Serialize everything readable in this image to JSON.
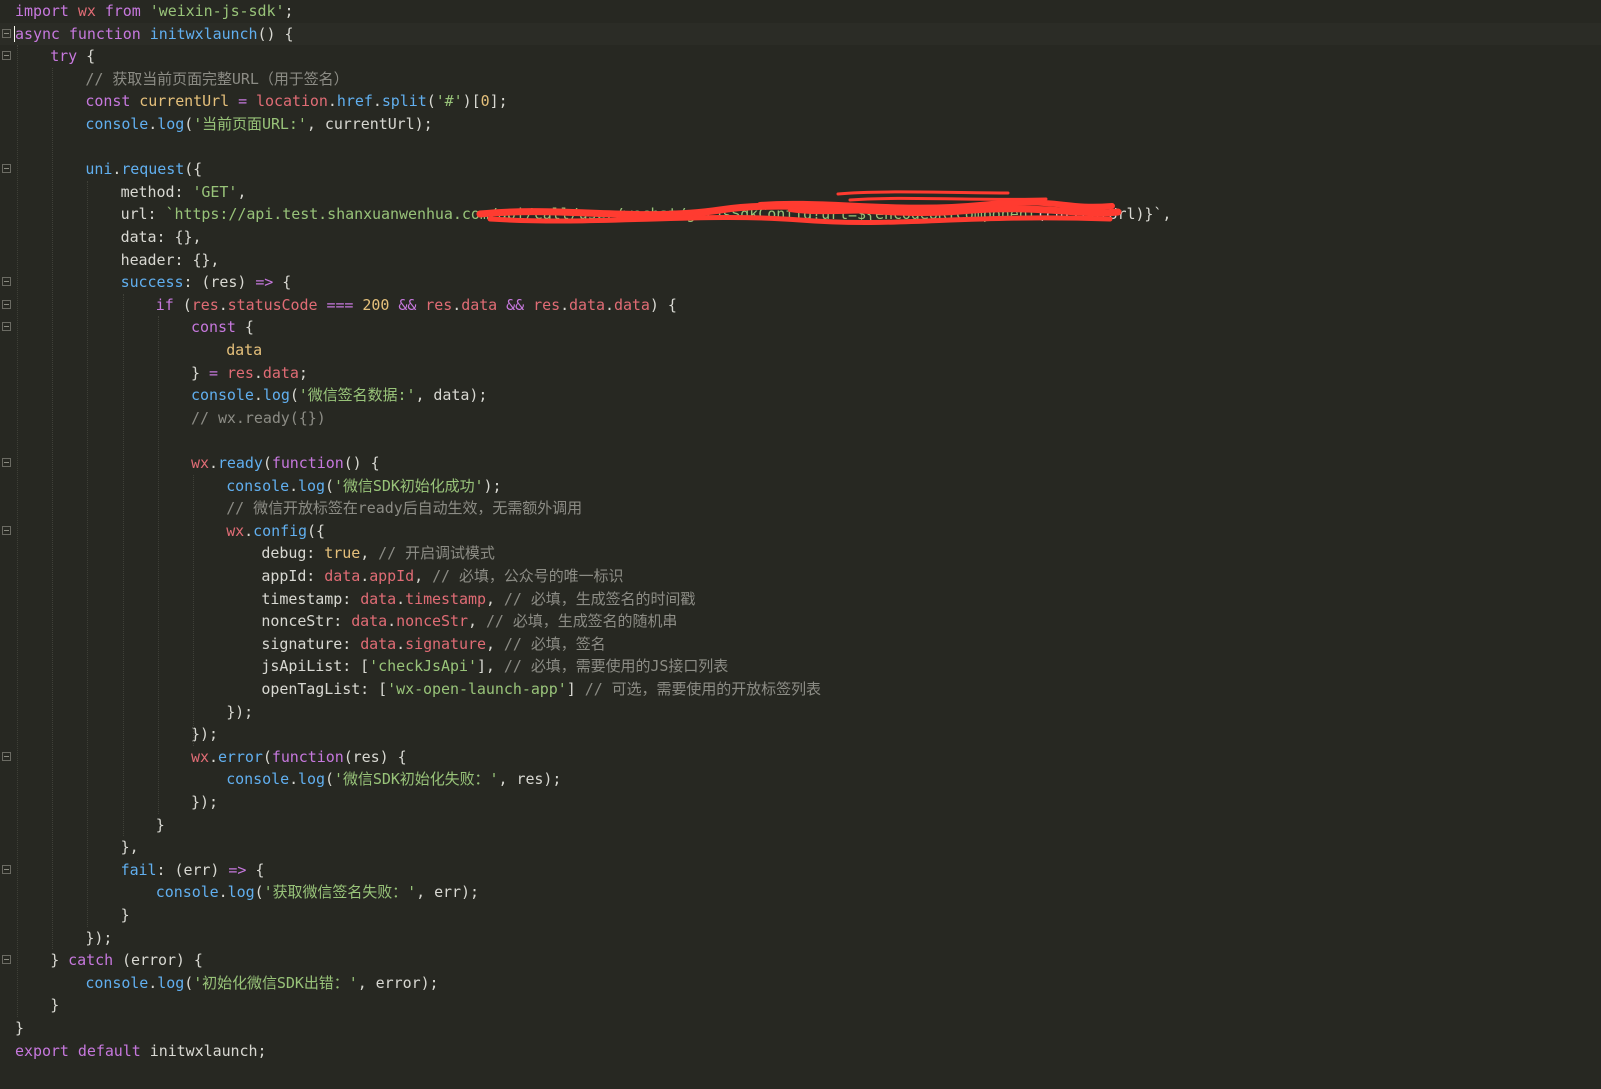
{
  "colors": {
    "background": "#272822",
    "text": "#d8d8d2",
    "keyword": "#c678dd",
    "function": "#61afef",
    "string": "#98c379",
    "number": "#e5c07b",
    "comment": "#8c8c85",
    "property": "#e06c75",
    "boolean": "#e5c07b",
    "redaction": "#ff3b30"
  },
  "editor": {
    "active_line": 2,
    "redaction_note": "redacted-url-segment"
  },
  "lines": [
    {
      "indent": 0,
      "fold": false,
      "tokens": [
        [
          "kw",
          "import"
        ],
        [
          "p",
          " "
        ],
        [
          "prop",
          "wx"
        ],
        [
          "p",
          " "
        ],
        [
          "kw",
          "from"
        ],
        [
          "p",
          " "
        ],
        [
          "str",
          "'weixin-js-sdk'"
        ],
        [
          "p",
          ";"
        ]
      ]
    },
    {
      "indent": 0,
      "fold": true,
      "tokens": [
        [
          "kw",
          "async"
        ],
        [
          "p",
          " "
        ],
        [
          "kw",
          "function"
        ],
        [
          "p",
          " "
        ],
        [
          "fn",
          "initwxlaunch"
        ],
        [
          "p",
          "() {"
        ]
      ]
    },
    {
      "indent": 1,
      "fold": true,
      "tokens": [
        [
          "kw",
          "try"
        ],
        [
          "p",
          " {"
        ]
      ]
    },
    {
      "indent": 2,
      "fold": false,
      "tokens": [
        [
          "cm",
          "// 获取当前页面完整URL（用于签名）"
        ]
      ]
    },
    {
      "indent": 2,
      "fold": false,
      "tokens": [
        [
          "kw",
          "const"
        ],
        [
          "p",
          " "
        ],
        [
          "num",
          "currentUrl"
        ],
        [
          "p",
          " "
        ],
        [
          "kw",
          "="
        ],
        [
          "p",
          " "
        ],
        [
          "prop",
          "location"
        ],
        [
          "p",
          "."
        ],
        [
          "fn",
          "href"
        ],
        [
          "p",
          "."
        ],
        [
          "fn",
          "split"
        ],
        [
          "p",
          "("
        ],
        [
          "str",
          "'#'"
        ],
        [
          "p",
          ")["
        ],
        [
          "num",
          "0"
        ],
        [
          "p",
          "];"
        ]
      ]
    },
    {
      "indent": 2,
      "fold": false,
      "tokens": [
        [
          "fn",
          "console"
        ],
        [
          "p",
          "."
        ],
        [
          "fn",
          "log"
        ],
        [
          "p",
          "("
        ],
        [
          "str",
          "'当前页面URL:'"
        ],
        [
          "p",
          ", currentUrl);"
        ]
      ]
    },
    {
      "indent": 0,
      "fold": false,
      "tokens": []
    },
    {
      "indent": 2,
      "fold": true,
      "tokens": [
        [
          "fn",
          "uni"
        ],
        [
          "p",
          "."
        ],
        [
          "fn",
          "request"
        ],
        [
          "p",
          "({"
        ]
      ]
    },
    {
      "indent": 3,
      "fold": false,
      "tokens": [
        [
          "p",
          "method: "
        ],
        [
          "str",
          "'GET'"
        ],
        [
          "p",
          ","
        ]
      ]
    },
    {
      "indent": 3,
      "fold": false,
      "tokens": [
        [
          "p",
          "url: "
        ],
        [
          "str",
          "`https://api.test.shanxuanwenhua.com/"
        ],
        [
          "str",
          "api/call/user/wechat/getJsSdkConfig?url=${encodeURIComponent"
        ],
        [
          "p",
          "(currentUrl)}`,"
        ]
      ]
    },
    {
      "indent": 3,
      "fold": false,
      "tokens": [
        [
          "p",
          "data: {},"
        ]
      ]
    },
    {
      "indent": 3,
      "fold": false,
      "tokens": [
        [
          "p",
          "header: {},"
        ]
      ]
    },
    {
      "indent": 3,
      "fold": true,
      "tokens": [
        [
          "fn",
          "success"
        ],
        [
          "p",
          ": (res) "
        ],
        [
          "kw",
          "=>"
        ],
        [
          "p",
          " {"
        ]
      ]
    },
    {
      "indent": 4,
      "fold": true,
      "tokens": [
        [
          "kw",
          "if"
        ],
        [
          "p",
          " ("
        ],
        [
          "prop",
          "res"
        ],
        [
          "p",
          "."
        ],
        [
          "prop",
          "statusCode"
        ],
        [
          "p",
          " "
        ],
        [
          "kw",
          "==="
        ],
        [
          "p",
          " "
        ],
        [
          "num",
          "200"
        ],
        [
          "p",
          " "
        ],
        [
          "kw",
          "&&"
        ],
        [
          "p",
          " "
        ],
        [
          "prop",
          "res"
        ],
        [
          "p",
          "."
        ],
        [
          "prop",
          "data"
        ],
        [
          "p",
          " "
        ],
        [
          "kw",
          "&&"
        ],
        [
          "p",
          " "
        ],
        [
          "prop",
          "res"
        ],
        [
          "p",
          "."
        ],
        [
          "prop",
          "data"
        ],
        [
          "p",
          "."
        ],
        [
          "prop",
          "data"
        ],
        [
          "p",
          ") {"
        ]
      ]
    },
    {
      "indent": 5,
      "fold": true,
      "tokens": [
        [
          "kw",
          "const"
        ],
        [
          "p",
          " {"
        ]
      ]
    },
    {
      "indent": 6,
      "fold": false,
      "tokens": [
        [
          "num",
          "data"
        ]
      ]
    },
    {
      "indent": 5,
      "fold": false,
      "tokens": [
        [
          "p",
          "} "
        ],
        [
          "kw",
          "="
        ],
        [
          "p",
          " "
        ],
        [
          "prop",
          "res"
        ],
        [
          "p",
          "."
        ],
        [
          "prop",
          "data"
        ],
        [
          "p",
          ";"
        ]
      ]
    },
    {
      "indent": 5,
      "fold": false,
      "tokens": [
        [
          "fn",
          "console"
        ],
        [
          "p",
          "."
        ],
        [
          "fn",
          "log"
        ],
        [
          "p",
          "("
        ],
        [
          "str",
          "'微信签名数据:'"
        ],
        [
          "p",
          ", data);"
        ]
      ]
    },
    {
      "indent": 5,
      "fold": false,
      "tokens": [
        [
          "cm",
          "// wx.ready({})"
        ]
      ]
    },
    {
      "indent": 0,
      "fold": false,
      "tokens": []
    },
    {
      "indent": 5,
      "fold": true,
      "tokens": [
        [
          "prop",
          "wx"
        ],
        [
          "p",
          "."
        ],
        [
          "fn",
          "ready"
        ],
        [
          "p",
          "("
        ],
        [
          "kw",
          "function"
        ],
        [
          "p",
          "() {"
        ]
      ]
    },
    {
      "indent": 6,
      "fold": false,
      "tokens": [
        [
          "fn",
          "console"
        ],
        [
          "p",
          "."
        ],
        [
          "fn",
          "log"
        ],
        [
          "p",
          "("
        ],
        [
          "str",
          "'微信SDK初始化成功'"
        ],
        [
          "p",
          ");"
        ]
      ]
    },
    {
      "indent": 6,
      "fold": false,
      "tokens": [
        [
          "cm",
          "// 微信开放标签在ready后自动生效，无需额外调用"
        ]
      ]
    },
    {
      "indent": 6,
      "fold": true,
      "tokens": [
        [
          "prop",
          "wx"
        ],
        [
          "p",
          "."
        ],
        [
          "fn",
          "config"
        ],
        [
          "p",
          "({"
        ]
      ]
    },
    {
      "indent": 7,
      "fold": false,
      "tokens": [
        [
          "p",
          "debug: "
        ],
        [
          "num",
          "true"
        ],
        [
          "p",
          ", "
        ],
        [
          "cm",
          "// 开启调试模式"
        ]
      ]
    },
    {
      "indent": 7,
      "fold": false,
      "tokens": [
        [
          "p",
          "appId: "
        ],
        [
          "prop",
          "data"
        ],
        [
          "p",
          "."
        ],
        [
          "prop",
          "appId"
        ],
        [
          "p",
          ", "
        ],
        [
          "cm",
          "// 必填，公众号的唯一标识"
        ]
      ]
    },
    {
      "indent": 7,
      "fold": false,
      "tokens": [
        [
          "p",
          "timestamp: "
        ],
        [
          "prop",
          "data"
        ],
        [
          "p",
          "."
        ],
        [
          "prop",
          "timestamp"
        ],
        [
          "p",
          ", "
        ],
        [
          "cm",
          "// 必填，生成签名的时间戳"
        ]
      ]
    },
    {
      "indent": 7,
      "fold": false,
      "tokens": [
        [
          "p",
          "nonceStr: "
        ],
        [
          "prop",
          "data"
        ],
        [
          "p",
          "."
        ],
        [
          "prop",
          "nonceStr"
        ],
        [
          "p",
          ", "
        ],
        [
          "cm",
          "// 必填，生成签名的随机串"
        ]
      ]
    },
    {
      "indent": 7,
      "fold": false,
      "tokens": [
        [
          "p",
          "signature: "
        ],
        [
          "prop",
          "data"
        ],
        [
          "p",
          "."
        ],
        [
          "prop",
          "signature"
        ],
        [
          "p",
          ", "
        ],
        [
          "cm",
          "// 必填，签名"
        ]
      ]
    },
    {
      "indent": 7,
      "fold": false,
      "tokens": [
        [
          "p",
          "jsApiList: ["
        ],
        [
          "str",
          "'checkJsApi'"
        ],
        [
          "p",
          "], "
        ],
        [
          "cm",
          "// 必填，需要使用的JS接口列表"
        ]
      ]
    },
    {
      "indent": 7,
      "fold": false,
      "tokens": [
        [
          "p",
          "openTagList: ["
        ],
        [
          "str",
          "'wx-open-launch-app'"
        ],
        [
          "p",
          "] "
        ],
        [
          "cm",
          "// 可选，需要使用的开放标签列表"
        ]
      ]
    },
    {
      "indent": 6,
      "fold": false,
      "tokens": [
        [
          "p",
          "});"
        ]
      ]
    },
    {
      "indent": 5,
      "fold": false,
      "tokens": [
        [
          "p",
          "});"
        ]
      ]
    },
    {
      "indent": 5,
      "fold": true,
      "tokens": [
        [
          "prop",
          "wx"
        ],
        [
          "p",
          "."
        ],
        [
          "fn",
          "error"
        ],
        [
          "p",
          "("
        ],
        [
          "kw",
          "function"
        ],
        [
          "p",
          "(res) {"
        ]
      ]
    },
    {
      "indent": 6,
      "fold": false,
      "tokens": [
        [
          "fn",
          "console"
        ],
        [
          "p",
          "."
        ],
        [
          "fn",
          "log"
        ],
        [
          "p",
          "("
        ],
        [
          "str",
          "'微信SDK初始化失败：'"
        ],
        [
          "p",
          ", res);"
        ]
      ]
    },
    {
      "indent": 5,
      "fold": false,
      "tokens": [
        [
          "p",
          "});"
        ]
      ]
    },
    {
      "indent": 4,
      "fold": false,
      "tokens": [
        [
          "p",
          "}"
        ]
      ]
    },
    {
      "indent": 3,
      "fold": false,
      "tokens": [
        [
          "p",
          "},"
        ]
      ]
    },
    {
      "indent": 3,
      "fold": true,
      "tokens": [
        [
          "fn",
          "fail"
        ],
        [
          "p",
          ": (err) "
        ],
        [
          "kw",
          "=>"
        ],
        [
          "p",
          " {"
        ]
      ]
    },
    {
      "indent": 4,
      "fold": false,
      "tokens": [
        [
          "fn",
          "console"
        ],
        [
          "p",
          "."
        ],
        [
          "fn",
          "log"
        ],
        [
          "p",
          "("
        ],
        [
          "str",
          "'获取微信签名失败：'"
        ],
        [
          "p",
          ", err);"
        ]
      ]
    },
    {
      "indent": 3,
      "fold": false,
      "tokens": [
        [
          "p",
          "}"
        ]
      ]
    },
    {
      "indent": 2,
      "fold": false,
      "tokens": [
        [
          "p",
          "});"
        ]
      ]
    },
    {
      "indent": 1,
      "fold": true,
      "tokens": [
        [
          "p",
          "} "
        ],
        [
          "kw",
          "catch"
        ],
        [
          "p",
          " (error) {"
        ]
      ]
    },
    {
      "indent": 2,
      "fold": false,
      "tokens": [
        [
          "fn",
          "console"
        ],
        [
          "p",
          "."
        ],
        [
          "fn",
          "log"
        ],
        [
          "p",
          "("
        ],
        [
          "str",
          "'初始化微信SDK出错：'"
        ],
        [
          "p",
          ", error);"
        ]
      ]
    },
    {
      "indent": 1,
      "fold": false,
      "tokens": [
        [
          "p",
          "}"
        ]
      ]
    },
    {
      "indent": 0,
      "fold": false,
      "tokens": [
        [
          "p",
          "}"
        ]
      ]
    },
    {
      "indent": 0,
      "fold": false,
      "tokens": [
        [
          "kw",
          "export"
        ],
        [
          "p",
          " "
        ],
        [
          "kw",
          "default"
        ],
        [
          "p",
          " initwxlaunch;"
        ]
      ]
    }
  ]
}
